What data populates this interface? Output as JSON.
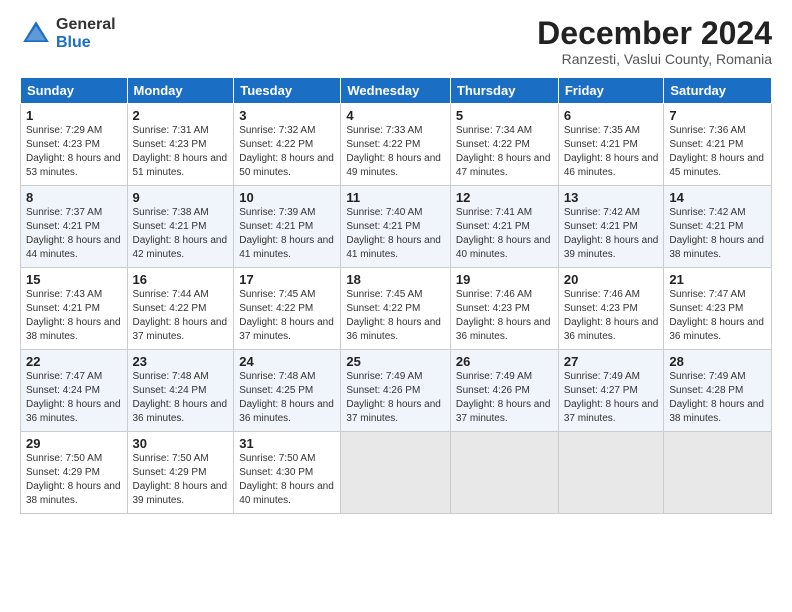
{
  "logo": {
    "general": "General",
    "blue": "Blue"
  },
  "header": {
    "month": "December 2024",
    "location": "Ranzesti, Vaslui County, Romania"
  },
  "weekdays": [
    "Sunday",
    "Monday",
    "Tuesday",
    "Wednesday",
    "Thursday",
    "Friday",
    "Saturday"
  ],
  "weeks": [
    [
      {
        "day": "1",
        "sunrise": "7:29 AM",
        "sunset": "4:23 PM",
        "daylight": "8 hours and 53 minutes."
      },
      {
        "day": "2",
        "sunrise": "7:31 AM",
        "sunset": "4:23 PM",
        "daylight": "8 hours and 51 minutes."
      },
      {
        "day": "3",
        "sunrise": "7:32 AM",
        "sunset": "4:22 PM",
        "daylight": "8 hours and 50 minutes."
      },
      {
        "day": "4",
        "sunrise": "7:33 AM",
        "sunset": "4:22 PM",
        "daylight": "8 hours and 49 minutes."
      },
      {
        "day": "5",
        "sunrise": "7:34 AM",
        "sunset": "4:22 PM",
        "daylight": "8 hours and 47 minutes."
      },
      {
        "day": "6",
        "sunrise": "7:35 AM",
        "sunset": "4:21 PM",
        "daylight": "8 hours and 46 minutes."
      },
      {
        "day": "7",
        "sunrise": "7:36 AM",
        "sunset": "4:21 PM",
        "daylight": "8 hours and 45 minutes."
      }
    ],
    [
      {
        "day": "8",
        "sunrise": "7:37 AM",
        "sunset": "4:21 PM",
        "daylight": "8 hours and 44 minutes."
      },
      {
        "day": "9",
        "sunrise": "7:38 AM",
        "sunset": "4:21 PM",
        "daylight": "8 hours and 42 minutes."
      },
      {
        "day": "10",
        "sunrise": "7:39 AM",
        "sunset": "4:21 PM",
        "daylight": "8 hours and 41 minutes."
      },
      {
        "day": "11",
        "sunrise": "7:40 AM",
        "sunset": "4:21 PM",
        "daylight": "8 hours and 41 minutes."
      },
      {
        "day": "12",
        "sunrise": "7:41 AM",
        "sunset": "4:21 PM",
        "daylight": "8 hours and 40 minutes."
      },
      {
        "day": "13",
        "sunrise": "7:42 AM",
        "sunset": "4:21 PM",
        "daylight": "8 hours and 39 minutes."
      },
      {
        "day": "14",
        "sunrise": "7:42 AM",
        "sunset": "4:21 PM",
        "daylight": "8 hours and 38 minutes."
      }
    ],
    [
      {
        "day": "15",
        "sunrise": "7:43 AM",
        "sunset": "4:21 PM",
        "daylight": "8 hours and 38 minutes."
      },
      {
        "day": "16",
        "sunrise": "7:44 AM",
        "sunset": "4:22 PM",
        "daylight": "8 hours and 37 minutes."
      },
      {
        "day": "17",
        "sunrise": "7:45 AM",
        "sunset": "4:22 PM",
        "daylight": "8 hours and 37 minutes."
      },
      {
        "day": "18",
        "sunrise": "7:45 AM",
        "sunset": "4:22 PM",
        "daylight": "8 hours and 36 minutes."
      },
      {
        "day": "19",
        "sunrise": "7:46 AM",
        "sunset": "4:23 PM",
        "daylight": "8 hours and 36 minutes."
      },
      {
        "day": "20",
        "sunrise": "7:46 AM",
        "sunset": "4:23 PM",
        "daylight": "8 hours and 36 minutes."
      },
      {
        "day": "21",
        "sunrise": "7:47 AM",
        "sunset": "4:23 PM",
        "daylight": "8 hours and 36 minutes."
      }
    ],
    [
      {
        "day": "22",
        "sunrise": "7:47 AM",
        "sunset": "4:24 PM",
        "daylight": "8 hours and 36 minutes."
      },
      {
        "day": "23",
        "sunrise": "7:48 AM",
        "sunset": "4:24 PM",
        "daylight": "8 hours and 36 minutes."
      },
      {
        "day": "24",
        "sunrise": "7:48 AM",
        "sunset": "4:25 PM",
        "daylight": "8 hours and 36 minutes."
      },
      {
        "day": "25",
        "sunrise": "7:49 AM",
        "sunset": "4:26 PM",
        "daylight": "8 hours and 37 minutes."
      },
      {
        "day": "26",
        "sunrise": "7:49 AM",
        "sunset": "4:26 PM",
        "daylight": "8 hours and 37 minutes."
      },
      {
        "day": "27",
        "sunrise": "7:49 AM",
        "sunset": "4:27 PM",
        "daylight": "8 hours and 37 minutes."
      },
      {
        "day": "28",
        "sunrise": "7:49 AM",
        "sunset": "4:28 PM",
        "daylight": "8 hours and 38 minutes."
      }
    ],
    [
      {
        "day": "29",
        "sunrise": "7:50 AM",
        "sunset": "4:29 PM",
        "daylight": "8 hours and 38 minutes."
      },
      {
        "day": "30",
        "sunrise": "7:50 AM",
        "sunset": "4:29 PM",
        "daylight": "8 hours and 39 minutes."
      },
      {
        "day": "31",
        "sunrise": "7:50 AM",
        "sunset": "4:30 PM",
        "daylight": "8 hours and 40 minutes."
      },
      null,
      null,
      null,
      null
    ]
  ]
}
